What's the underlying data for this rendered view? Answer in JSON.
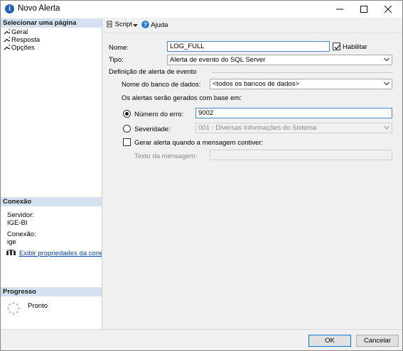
{
  "window": {
    "title": "Novo Alerta"
  },
  "sidebar": {
    "select_page_header": "Selecionar uma página",
    "pages": [
      {
        "label": "Geral"
      },
      {
        "label": "Resposta"
      },
      {
        "label": "Opções"
      }
    ],
    "connection_header": "Conexão",
    "server_label": "Servidor:",
    "server_value": "IGE-BI",
    "connection_label": "Conexão:",
    "connection_value": "ige",
    "view_props_link": "Exibir propriedades da conexão",
    "progress_header": "Progresso",
    "progress_status": "Pronto"
  },
  "toolbar": {
    "script_label": "Script",
    "help_label": "Ajuda"
  },
  "form": {
    "name_label": "Nome:",
    "name_value": "LOG_FULL",
    "enable_label": "Habilitar",
    "enable_checked": true,
    "type_label": "Tipo:",
    "type_value": "Alerta de evento do SQL Server",
    "event_def_label": "Definição de alerta de evento",
    "db_name_label": "Nome do banco de dados:",
    "db_name_value": "<todos os bancos de dados>",
    "based_on_label": "Os alertas serão gerados com base em:",
    "error_number_label": "Número do erro:",
    "error_number_value": "9002",
    "error_number_selected": true,
    "severity_label": "Severidade:",
    "severity_value": "001 - Diversas Informações do Sistema",
    "raise_msg_label": "Gerar alerta quando a mensagem contiver:",
    "raise_msg_checked": false,
    "msg_text_label": "Texto da mensagem:",
    "msg_text_value": ""
  },
  "footer": {
    "ok_label": "OK",
    "cancel_label": "Cancelar"
  },
  "colors": {
    "section_header_bg": "#d4e1ee",
    "link": "#0645ad",
    "focus_border": "#4a88d0",
    "primary_border": "#0078d7"
  }
}
